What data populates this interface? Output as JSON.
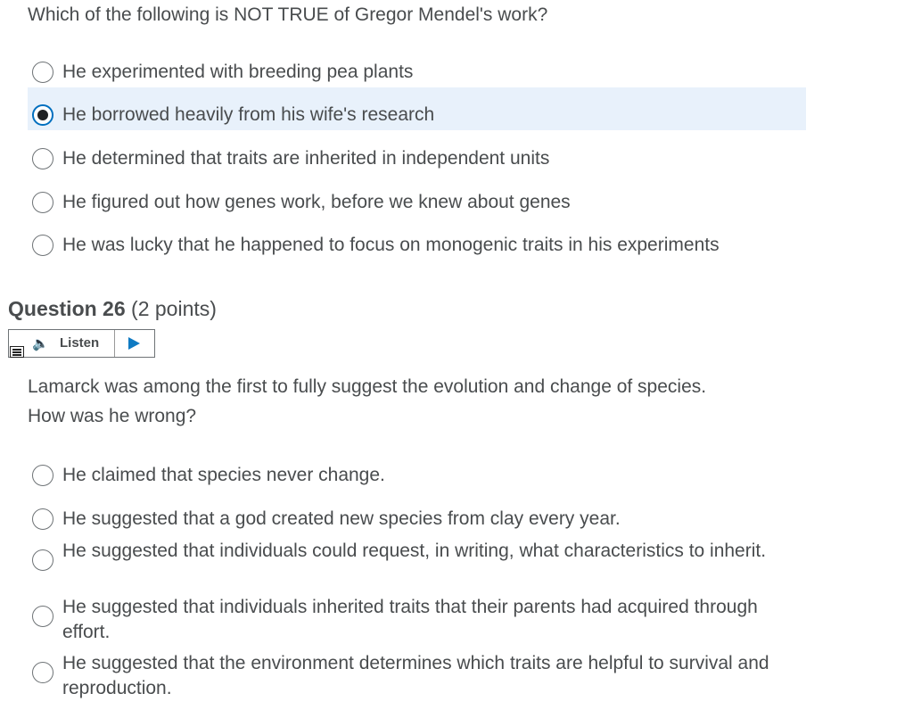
{
  "q1": {
    "prompt": "Which of the following is NOT TRUE of Gregor Mendel's work?",
    "options": [
      {
        "label": "He experimented with breeding pea plants",
        "selected": false
      },
      {
        "label": "He borrowed heavily from his wife's research",
        "selected": true
      },
      {
        "label": "He determined that traits are inherited in independent units",
        "selected": false
      },
      {
        "label": "He figured out how genes work, before we knew about genes",
        "selected": false
      },
      {
        "label": "He was lucky that he happened to focus on monogenic traits in his experiments",
        "selected": false
      }
    ]
  },
  "q2": {
    "heading_bold": "Question 26",
    "heading_points": " (2 points)",
    "listen_label": "Listen",
    "prompt_line1": "Lamarck was among the first to fully suggest the evolution and change of species.",
    "prompt_line2": "How was he wrong?",
    "options": [
      {
        "label": "He claimed that species never change.",
        "selected": false
      },
      {
        "label": "He suggested that a god created new species from clay every year.",
        "selected": false
      },
      {
        "label": "He suggested that individuals could request, in writing, what characteristics to inherit.",
        "selected": false
      },
      {
        "label": "He suggested that individuals inherited traits that their parents had acquired through effort.",
        "selected": false
      },
      {
        "label": "He suggested that the environment determines which traits are helpful to survival and reproduction.",
        "selected": false
      }
    ]
  },
  "colors": {
    "selected_bg": "#e8f1fb",
    "text": "#494c4e",
    "accent": "#006fbf",
    "play": "#0f7ac2"
  },
  "icons": {
    "speaker": "speaker-icon",
    "play": "play-icon",
    "menu": "menu-icon"
  }
}
